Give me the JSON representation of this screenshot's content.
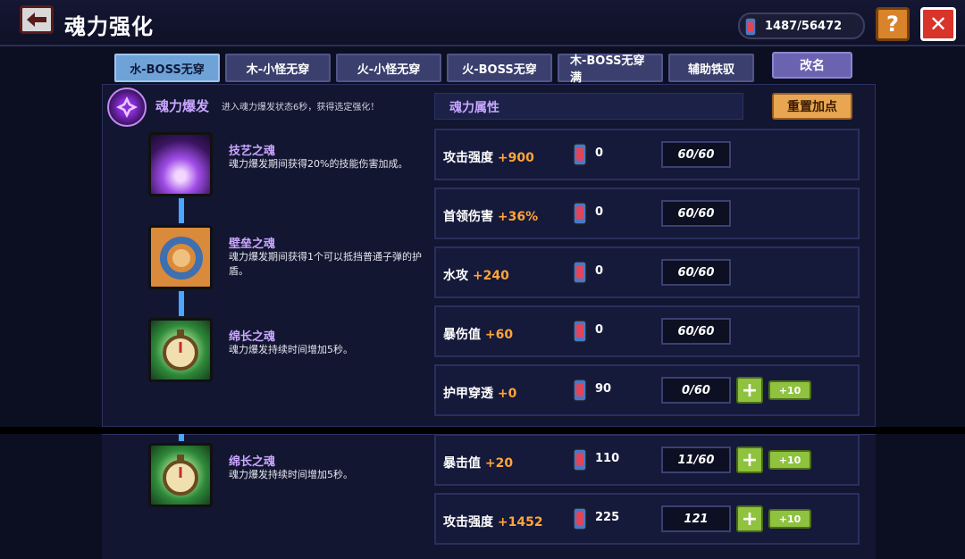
{
  "header": {
    "title": "魂力强化",
    "currency": "1487/56472"
  },
  "tabs": [
    {
      "label": "水-BOSS无穿",
      "active": true
    },
    {
      "label": "木-小怪无穿",
      "active": false
    },
    {
      "label": "火-小怪无穿",
      "active": false
    },
    {
      "label": "火-BOSS无穿",
      "active": false
    },
    {
      "label": "木-BOSS无穿满",
      "active": false
    },
    {
      "label": "辅助铁驭",
      "active": false
    }
  ],
  "rename_label": "改名",
  "burst": {
    "title": "魂力爆发",
    "desc": "进入魂力爆发状态6秒，获得选定强化！"
  },
  "attr_header": "魂力属性",
  "reset_label": "重置加点",
  "skills": [
    {
      "name": "技艺之魂",
      "desc": "魂力爆发期间获得20%的技能伤害加成。",
      "icon": "purple-flame-icon"
    },
    {
      "name": "壁垒之魂",
      "desc": "魂力爆发期间获得1个可以抵挡普通子弹的护盾。",
      "icon": "shield-ring-icon"
    },
    {
      "name": "绵长之魂",
      "desc": "魂力爆发持续时间增加5秒。",
      "icon": "stopwatch-icon"
    },
    {
      "name": "绵长之魂",
      "desc": "魂力爆发持续时间增加5秒。",
      "icon": "stopwatch-icon"
    }
  ],
  "attributes": [
    {
      "name": "攻击强度",
      "bonus": "+900",
      "count": "0",
      "level": "60/60",
      "plus": false
    },
    {
      "name": "首领伤害",
      "bonus": "+36%",
      "count": "0",
      "level": "60/60",
      "plus": false
    },
    {
      "name": "水攻",
      "bonus": "+240",
      "count": "0",
      "level": "60/60",
      "plus": false
    },
    {
      "name": "暴伤值",
      "bonus": "+60",
      "count": "0",
      "level": "60/60",
      "plus": false
    },
    {
      "name": "护甲穿透",
      "bonus": "+0",
      "count": "90",
      "level": "0/60",
      "plus": true,
      "plus_label": "+",
      "plus10_label": "+10"
    },
    {
      "name": "暴击值",
      "bonus": "+20",
      "count": "110",
      "level": "11/60",
      "plus": true,
      "plus_label": "+",
      "plus10_label": "+10"
    },
    {
      "name": "攻击强度",
      "bonus": "+1452",
      "count": "225",
      "level": "121",
      "plus": true,
      "plus_label": "+",
      "plus10_label": "+10"
    }
  ],
  "colors": {
    "accent_purple": "#c9a6ff",
    "bonus_orange": "#ffa43a",
    "plus_green": "#8ec23f"
  }
}
